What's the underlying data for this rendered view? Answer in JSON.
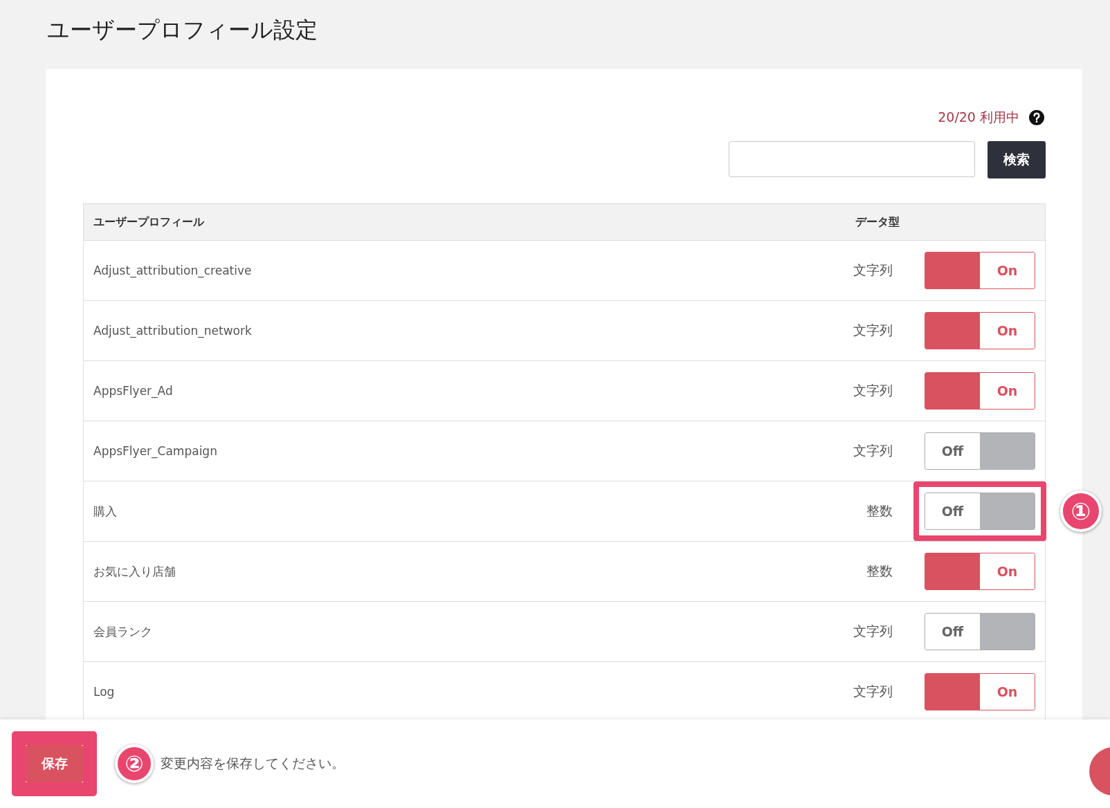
{
  "title": "ユーザープロフィール設定",
  "usage": {
    "text": "20/20 利用中"
  },
  "search": {
    "button": "検索"
  },
  "table": {
    "columns": [
      "ユーザープロフィール",
      "データ型"
    ],
    "rows": [
      {
        "name": "Adjust_attribution_creative",
        "type": "文字列",
        "on": true,
        "label": "On",
        "highlighted": false
      },
      {
        "name": "Adjust_attribution_network",
        "type": "文字列",
        "on": true,
        "label": "On",
        "highlighted": false
      },
      {
        "name": "AppsFlyer_Ad",
        "type": "文字列",
        "on": true,
        "label": "On",
        "highlighted": false
      },
      {
        "name": "AppsFlyer_Campaign",
        "type": "文字列",
        "on": false,
        "label": "Off",
        "highlighted": false
      },
      {
        "name": "購入",
        "type": "整数",
        "on": false,
        "label": "Off",
        "highlighted": true,
        "annotation": "①"
      },
      {
        "name": "お気に入り店舗",
        "type": "整数",
        "on": true,
        "label": "On",
        "highlighted": false
      },
      {
        "name": "会員ランク",
        "type": "文字列",
        "on": false,
        "label": "Off",
        "highlighted": false
      },
      {
        "name": "Log",
        "type": "文字列",
        "on": true,
        "label": "On",
        "highlighted": false
      }
    ]
  },
  "footer": {
    "button": "保存",
    "highlighted": true,
    "annotation": "②",
    "message": "変更内容を保存してください。"
  }
}
